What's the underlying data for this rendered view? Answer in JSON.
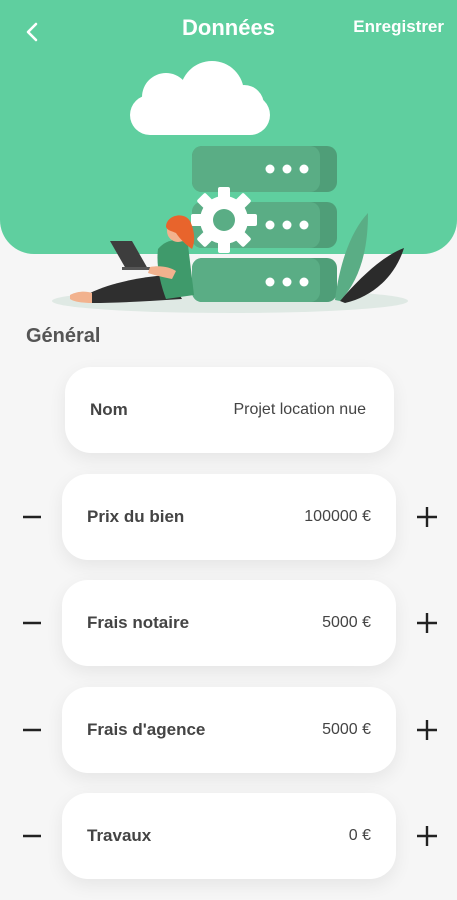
{
  "header": {
    "title": "Données",
    "save_label": "Enregistrer",
    "back_icon": "chevron-left-icon",
    "background_color": "#5fcf9f"
  },
  "section": {
    "title": "Général"
  },
  "fields": [
    {
      "label": "Nom",
      "value": "Projet location nue"
    },
    {
      "label": "Prix du bien",
      "value": "100000 €"
    },
    {
      "label": "Frais notaire",
      "value": "5000 €"
    },
    {
      "label": "Frais d'agence",
      "value": "5000 €"
    },
    {
      "label": "Travaux",
      "value": "0 €"
    }
  ],
  "icons": {
    "decrement": "minus-icon",
    "increment": "plus-icon"
  }
}
